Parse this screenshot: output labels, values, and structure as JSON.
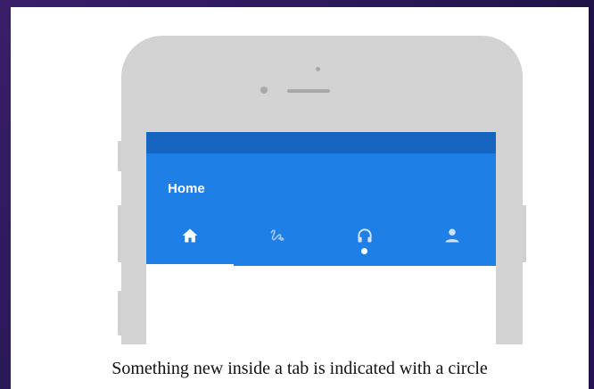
{
  "app": {
    "title": "Home"
  },
  "tabs": [
    {
      "icon": "home-icon",
      "selected": true,
      "has_new_indicator": false
    },
    {
      "icon": "gesture-icon",
      "selected": false,
      "has_new_indicator": false
    },
    {
      "icon": "headset-icon",
      "selected": false,
      "has_new_indicator": true
    },
    {
      "icon": "person-icon",
      "selected": false,
      "has_new_indicator": false
    }
  ],
  "caption": "Something new inside a tab is indicated with a circle",
  "colors": {
    "status_bar": "#1565c0",
    "app_bar": "#1e7fe6",
    "background": "#2a1858",
    "device": "#d3d3d3"
  }
}
